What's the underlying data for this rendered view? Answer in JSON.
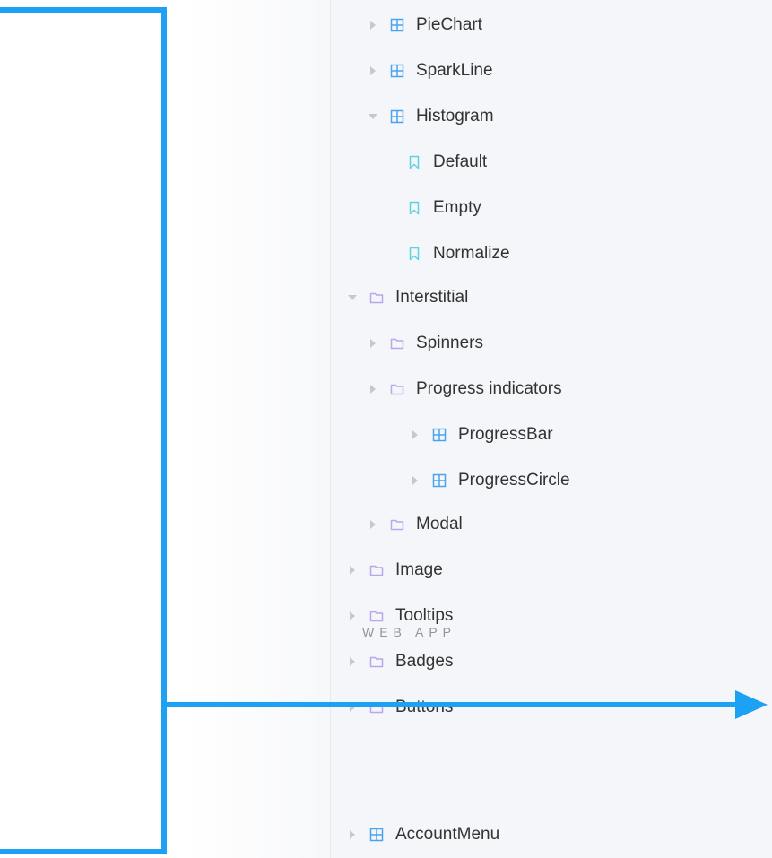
{
  "colors": {
    "component_icon": "#4aa3f0",
    "story_icon": "#5ed3e0",
    "folder_icon": "#b8a6ee",
    "annotation": "#1da1f2"
  },
  "tree": [
    {
      "label": "PieChart",
      "kind": "component",
      "expanded": false
    },
    {
      "label": "SparkLine",
      "kind": "component",
      "expanded": false
    },
    {
      "label": "Histogram",
      "kind": "component",
      "expanded": true
    },
    {
      "label": "Default",
      "kind": "story"
    },
    {
      "label": "Empty",
      "kind": "story"
    },
    {
      "label": "Normalize",
      "kind": "story"
    },
    {
      "label": "Interstitial",
      "kind": "folder",
      "expanded": true
    },
    {
      "label": "Spinners",
      "kind": "folder",
      "expanded": false
    },
    {
      "label": "Progress indicators",
      "kind": "folder",
      "expanded": false
    },
    {
      "label": "ProgressBar",
      "kind": "component",
      "expanded": false
    },
    {
      "label": "ProgressCircle",
      "kind": "component",
      "expanded": false
    },
    {
      "label": "Modal",
      "kind": "folder",
      "expanded": false
    },
    {
      "label": "Image",
      "kind": "folder",
      "expanded": false
    },
    {
      "label": "Tooltips",
      "kind": "folder",
      "expanded": false
    },
    {
      "label": "Badges",
      "kind": "folder",
      "expanded": false
    },
    {
      "label": "Buttons",
      "kind": "folder",
      "expanded": false
    }
  ],
  "section": {
    "title": "WEB APP"
  },
  "web_app_tree": [
    {
      "label": "AccountMenu",
      "kind": "component",
      "expanded": false
    }
  ]
}
